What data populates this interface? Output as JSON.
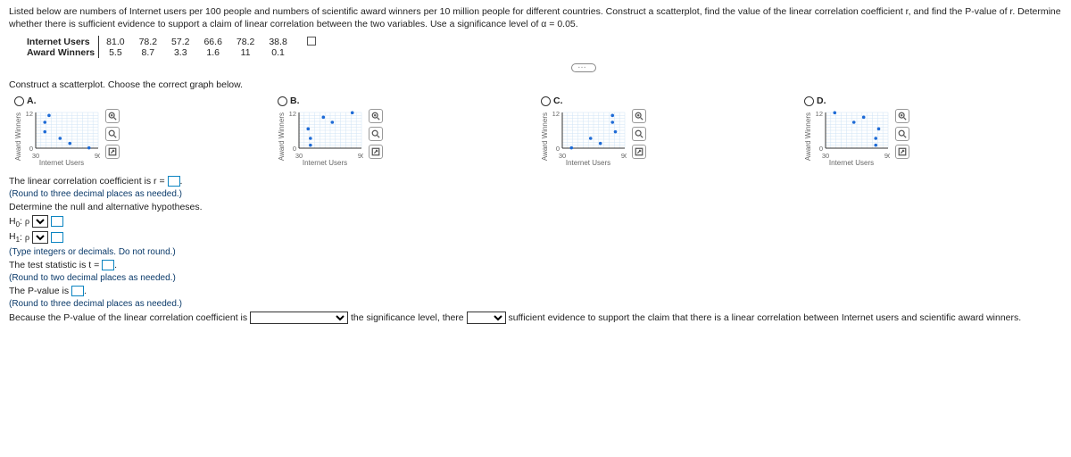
{
  "problem": {
    "intro": "Listed below are numbers of Internet users per 100 people and numbers of scientific award winners per 10 million people for different countries. Construct a scatterplot, find the value of the linear correlation coefficient r, and find the P-value of r. Determine whether there is sufficient evidence to support a claim of linear correlation between the two variables. Use a significance level of α = 0.05."
  },
  "table": {
    "row1_label": "Internet Users",
    "row2_label": "Award Winners",
    "internet": [
      "81.0",
      "78.2",
      "57.2",
      "66.6",
      "78.2",
      "38.8"
    ],
    "awards": [
      "5.5",
      "8.7",
      "3.3",
      "1.6",
      "11",
      "0.1"
    ]
  },
  "scatter_prompt": "Construct a scatterplot. Choose the correct graph below.",
  "options": {
    "A": "A.",
    "B": "B.",
    "C": "C.",
    "D": "D."
  },
  "axes": {
    "xmin": "30",
    "xmax": "90",
    "ymin": "0",
    "ymax": "12",
    "xtitle": "Internet Users",
    "ytitle": "Award Winners"
  },
  "chart_data": [
    {
      "type": "scatter",
      "option": "A",
      "x": [
        38.8,
        38.8,
        53.4,
        62.8,
        42.8,
        81.2
      ],
      "y": [
        5.5,
        8.7,
        3.3,
        1.6,
        11,
        0.1
      ],
      "xlim": [
        30,
        90
      ],
      "ylim": [
        0,
        12
      ],
      "xlabel": "Internet Users",
      "ylabel": "Award Winners"
    },
    {
      "type": "scatter",
      "option": "B",
      "x": [
        38.8,
        41.0,
        62.0,
        53.4,
        41.0,
        81.2
      ],
      "y": [
        6.5,
        3.3,
        8.7,
        10.4,
        1.0,
        11.9
      ],
      "xlim": [
        30,
        90
      ],
      "ylim": [
        0,
        12
      ],
      "xlabel": "Internet Users",
      "ylabel": "Award Winners"
    },
    {
      "type": "scatter",
      "option": "C",
      "x": [
        81.0,
        78.2,
        57.2,
        66.6,
        78.2,
        38.8
      ],
      "y": [
        5.5,
        8.7,
        3.3,
        1.6,
        11,
        0.1
      ],
      "xlim": [
        30,
        90
      ],
      "ylim": [
        0,
        12
      ],
      "xlabel": "Internet Users",
      "ylabel": "Award Winners"
    },
    {
      "type": "scatter",
      "option": "D",
      "x": [
        81.0,
        78.2,
        57.2,
        66.6,
        78.2,
        38.8
      ],
      "y": [
        6.5,
        3.3,
        8.7,
        10.4,
        1.0,
        11.9
      ],
      "xlim": [
        30,
        90
      ],
      "ylim": [
        0,
        12
      ],
      "xlabel": "Internet Users",
      "ylabel": "Award Winners"
    }
  ],
  "q2": {
    "line1_a": "The linear correlation coefficient is r =",
    "hint1": "(Round to three decimal places as needed.)",
    "line2": "Determine the null and alternative hypotheses.",
    "h0": "H",
    "h0sub": "0",
    "colon": ": ",
    "rho": "ρ",
    "h1": "H",
    "h1sub": "1",
    "hint2": "(Type integers or decimals. Do not round.)",
    "teststat": "The test statistic is t =",
    "hint3": "(Round to two decimal places as needed.)",
    "pval": "The P-value is",
    "hint4": "(Round to three decimal places as needed.)",
    "conclusion_a": "Because the P-value of the linear correlation coefficient is",
    "conclusion_b": "the significance level, there",
    "conclusion_c": "sufficient evidence to support the claim that there is a linear correlation between Internet users and scientific award winners."
  }
}
